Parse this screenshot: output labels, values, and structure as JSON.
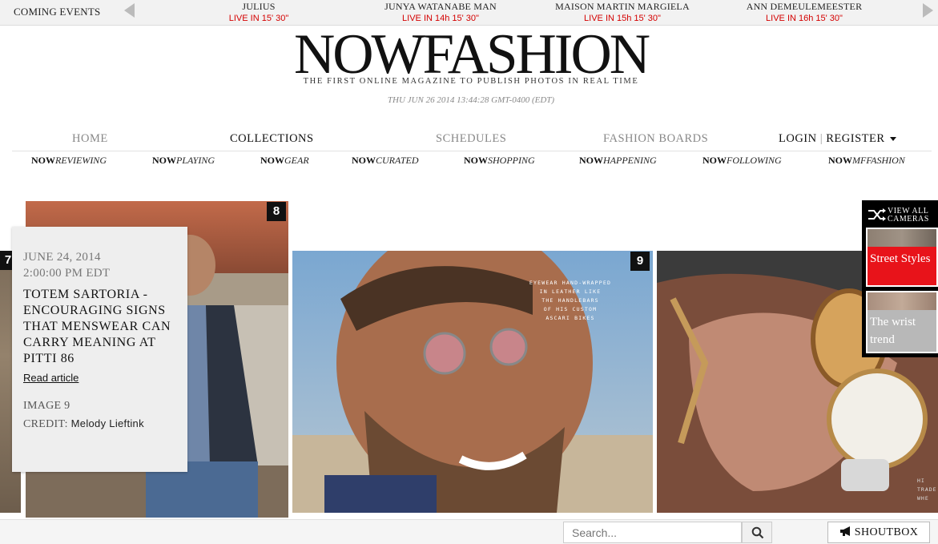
{
  "events_bar": {
    "label": "COMING EVENTS",
    "events": [
      {
        "name": "JULIUS",
        "time": "LIVE IN 15' 30\""
      },
      {
        "name": "JUNYA WATANABE MAN",
        "time": "LIVE IN 14h 15' 30\""
      },
      {
        "name": "MAISON MARTIN MARGIELA",
        "time": "LIVE IN 15h 15' 30\""
      },
      {
        "name": "ANN DEMEULEMEESTER",
        "time": "LIVE IN 16h 15' 30\""
      }
    ]
  },
  "header": {
    "logo": "NOWFASHION",
    "tagline": "THE FIRST ONLINE MAGAZINE TO PUBLISH PHOTOS IN REAL TIME",
    "datetime": "THU JUN 26 2014  13:44:28  GMT-0400 (EDT)"
  },
  "nav": {
    "home": "HOME",
    "collections": "COLLECTIONS",
    "schedules": "SCHEDULES",
    "fashion_boards": "FASHION BOARDS",
    "login": "LOGIN",
    "separator": "|",
    "register": "REGISTER"
  },
  "subnav": [
    {
      "prefix": "NOW",
      "suffix": "REVIEWING"
    },
    {
      "prefix": "NOW",
      "suffix": "PLAYING"
    },
    {
      "prefix": "NOW",
      "suffix": "GEAR"
    },
    {
      "prefix": "NOW",
      "suffix": "CURATED"
    },
    {
      "prefix": "NOW",
      "suffix": "SHOPPING"
    },
    {
      "prefix": "NOW",
      "suffix": "HAPPENING"
    },
    {
      "prefix": "NOW",
      "suffix": "FOLLOWING"
    },
    {
      "prefix": "NOW",
      "suffix": "MFFASHION"
    }
  ],
  "gallery": {
    "badges": [
      "7",
      "8",
      "9"
    ],
    "overlay_text": "EYEWEAR HAND-WRAPPED\nIN LEATHER LIKE\nTHE HANDLEBARS\nOF HIS CUSTOM\nASCARI BIKES",
    "right_overlay_text": "HI\nTRADE\nWHE"
  },
  "info_card": {
    "date": "JUNE 24, 2014",
    "time": "2:00:00 PM EDT",
    "title": "TOTEM SARTORIA - ENCOURAGING SIGNS THAT MENSWEAR CAN CARRY MEANING AT PITTI 86",
    "link": "Read article",
    "image": "IMAGE 9",
    "credit_label": "CREDIT:",
    "credit_name": "Melody Lieftink"
  },
  "side_panel": {
    "view_all": "VIEW ALL CAMERAS",
    "tiles": [
      {
        "label": "Street Styles"
      },
      {
        "label": "The wrist trend"
      }
    ]
  },
  "bottom_bar": {
    "search_placeholder": "Search...",
    "shoutbox": "SHOUTBOX"
  },
  "colors": {
    "live_red": "#d40000",
    "street_styles_tile": "#e8131a"
  }
}
